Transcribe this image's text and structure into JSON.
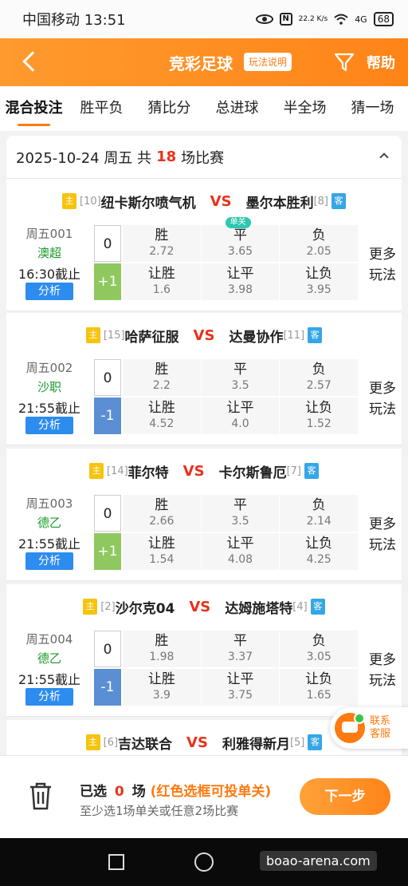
{
  "status": {
    "carrier_time": "中国移动 13:51",
    "speed": "22.2 K/s",
    "signal": "4G",
    "battery": "68"
  },
  "appbar": {
    "title": "竞彩足球",
    "rules": "玩法说明",
    "help": "帮助"
  },
  "tabs": [
    "混合投注",
    "胜平负",
    "猜比分",
    "总进球",
    "半全场",
    "猜一场"
  ],
  "date_header": {
    "prefix": "2025-10-24 周五 共",
    "count": "18",
    "suffix": "场比赛"
  },
  "labels": {
    "home": "主",
    "away": "客",
    "vs": "VS",
    "analyze": "分析",
    "more_line1": "更多",
    "more_line2": "玩法",
    "zero": "0",
    "win": "胜",
    "draw": "平",
    "lose": "负",
    "hwin": "让胜",
    "hdraw": "让平",
    "hlose": "让负",
    "single": "单关"
  },
  "matches": [
    {
      "home_rank": "[10]",
      "home": "纽卡斯尔喷气机",
      "away": "墨尔本胜利",
      "away_rank": "[8]",
      "code": "周五001",
      "league": "澳超",
      "deadline": "16:30截止",
      "handicap": "+1",
      "win": "2.72",
      "draw": "3.65",
      "lose": "2.05",
      "hwin": "1.6",
      "hdraw": "3.98",
      "hlose": "3.95"
    },
    {
      "home_rank": "[15]",
      "home": "哈萨征服",
      "away": "达曼协作",
      "away_rank": "[11]",
      "code": "周五002",
      "league": "沙职",
      "deadline": "21:55截止",
      "handicap": "-1",
      "win": "2.2",
      "draw": "3.5",
      "lose": "2.57",
      "hwin": "4.52",
      "hdraw": "4.0",
      "hlose": "1.52"
    },
    {
      "home_rank": "[14]",
      "home": "菲尔特",
      "away": "卡尔斯鲁厄",
      "away_rank": "[7]",
      "code": "周五003",
      "league": "德乙",
      "deadline": "21:55截止",
      "handicap": "+1",
      "win": "2.66",
      "draw": "3.5",
      "lose": "2.14",
      "hwin": "1.54",
      "hdraw": "4.08",
      "hlose": "4.25"
    },
    {
      "home_rank": "[2]",
      "home": "沙尔克04",
      "away": "达姆施塔特",
      "away_rank": "[4]",
      "code": "周五004",
      "league": "德乙",
      "deadline": "21:55截止",
      "handicap": "-1",
      "win": "1.98",
      "draw": "3.37",
      "lose": "3.05",
      "hwin": "3.9",
      "hdraw": "3.75",
      "hlose": "1.65"
    },
    {
      "home_rank": "[6]",
      "home": "吉达联合",
      "away": "利雅得新月",
      "away_rank": "[5]"
    }
  ],
  "customer_service": {
    "line1": "联系",
    "line2": "客服"
  },
  "bottom": {
    "selected_prefix": "已选",
    "selected_count": "0",
    "selected_suffix": "场",
    "selected_hint": "(红色选框可投单关)",
    "hint": "至少选1场单关或任意2场比赛",
    "next": "下一步"
  },
  "watermark": "boao-arena.com"
}
